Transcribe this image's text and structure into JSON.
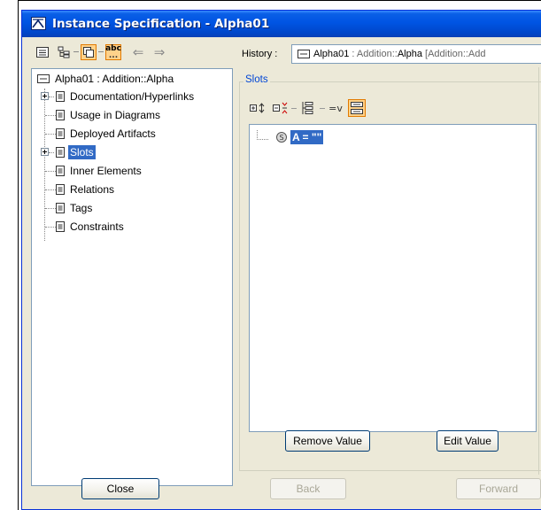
{
  "window": {
    "title": "Instance Specification - Alpha01"
  },
  "toolbar": {
    "buttons": [
      {
        "name": "tree-view-icon"
      },
      {
        "name": "hierarchy-icon"
      },
      {
        "name": "pages-icon",
        "active": true
      },
      {
        "name": "abc-icon",
        "active": true,
        "text": "abc"
      },
      {
        "name": "back-arrow-icon"
      },
      {
        "name": "forward-arrow-icon"
      }
    ],
    "history_label": "History :",
    "history_value_name": "Alpha01",
    "history_value_type": " : Addition::",
    "history_value_class": "Alpha",
    "history_value_tail": " [Addition::Add"
  },
  "tree": {
    "root": {
      "name": "Alpha01",
      "type": " : Addition::Alpha"
    },
    "items": [
      {
        "label": "Documentation/Hyperlinks",
        "expandable": true
      },
      {
        "label": "Usage in Diagrams"
      },
      {
        "label": "Deployed Artifacts"
      },
      {
        "label": "Slots",
        "expandable": true,
        "selected": true
      },
      {
        "label": "Inner Elements"
      },
      {
        "label": "Relations"
      },
      {
        "label": "Tags"
      },
      {
        "label": "Constraints"
      }
    ]
  },
  "slots": {
    "group_label": "Slots",
    "entry": "A = \"\"",
    "remove_value_label": "Remove Value",
    "edit_value_label": "Edit Value"
  },
  "footer": {
    "close_label": "Close",
    "back_label": "Back",
    "forward_label": "Forward"
  },
  "colors": {
    "titlebar": "#0054e3",
    "selection": "#316ac5",
    "active_button": "#ffd28a",
    "slots_legend": "#0046d5"
  }
}
